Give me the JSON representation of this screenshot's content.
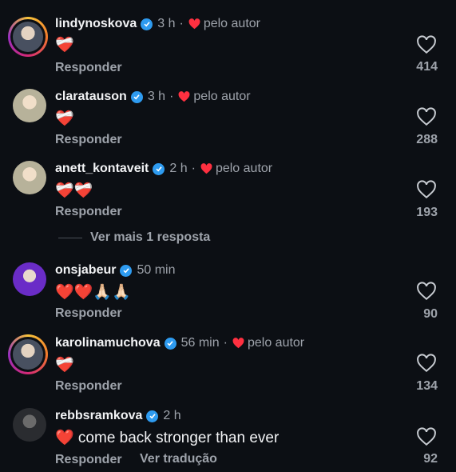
{
  "comments": [
    {
      "username": "lindynoskova",
      "time": "3 h",
      "liked_by_author": true,
      "author_label": "pelo autor",
      "body": "❤️‍🩹",
      "reply_label": "Responder",
      "likes": "414"
    },
    {
      "username": "claratauson",
      "time": "3 h",
      "liked_by_author": true,
      "author_label": "pelo autor",
      "body": "❤️‍🩹",
      "reply_label": "Responder",
      "likes": "288"
    },
    {
      "username": "anett_kontaveit",
      "time": "2 h",
      "liked_by_author": true,
      "author_label": "pelo autor",
      "body": "❤️‍🩹❤️‍🩹",
      "reply_label": "Responder",
      "likes": "193"
    },
    {
      "username": "onsjabeur",
      "time": "50 min",
      "liked_by_author": false,
      "body": "❤️❤️🙏🏻🙏🏻",
      "reply_label": "Responder",
      "likes": "90"
    },
    {
      "username": "karolinamuchova",
      "time": "56 min",
      "liked_by_author": true,
      "author_label": "pelo autor",
      "body": "❤️‍🩹",
      "reply_label": "Responder",
      "likes": "134"
    },
    {
      "username": "rebbsramkova",
      "time": "2 h",
      "liked_by_author": false,
      "body": "❤️ come back stronger than ever",
      "reply_label": "Responder",
      "translate_label": "Ver tradução",
      "likes": "92"
    }
  ],
  "view_more_replies": "Ver mais 1 resposta",
  "dot": "·",
  "icons": {
    "verified": "verified-badge-icon",
    "like": "heart-outline-icon",
    "author_like": "red-heart-icon"
  },
  "colors": {
    "background": "#0c0f14",
    "verified": "#2e9bf0",
    "author_heart": "#ff3040",
    "muted": "#9ea3ab"
  }
}
